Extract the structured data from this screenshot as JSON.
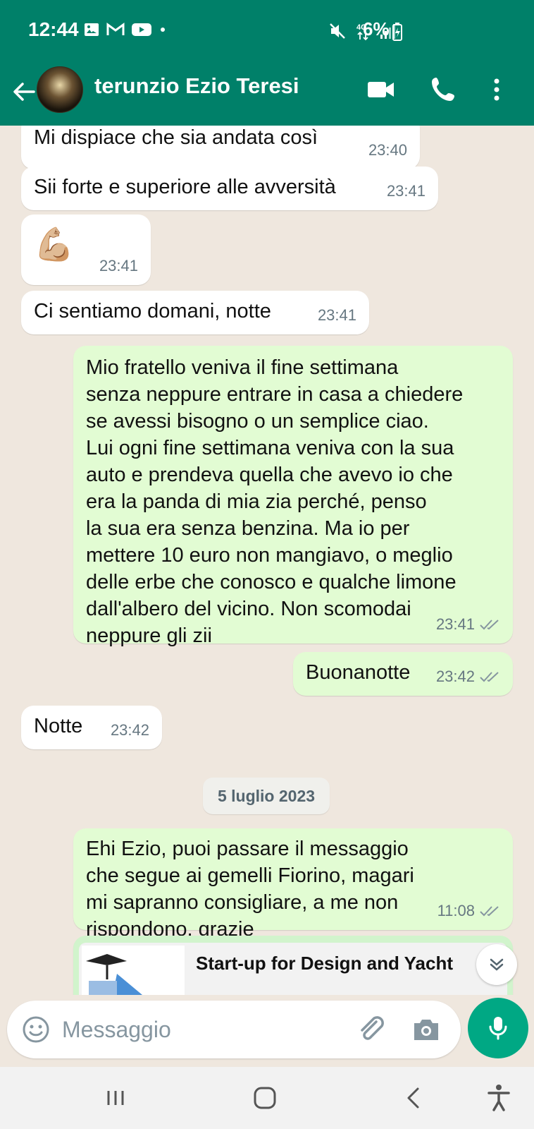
{
  "status_bar": {
    "time": "12:44",
    "battery": "6%",
    "network": "4G",
    "left_icons": [
      "image-icon",
      "gmail-icon",
      "youtube-icon",
      "dot-icon"
    ],
    "right_icons": [
      "mute-icon",
      "network-4g-icon",
      "signal-icon",
      "battery-charging-icon"
    ]
  },
  "header": {
    "contact_name": "terunzio Ezio Teresi",
    "accent_color": "#008069"
  },
  "messages": [
    {
      "dir": "in",
      "text": "Mi dispiace che sia andata così",
      "time": "23:40"
    },
    {
      "dir": "in",
      "text": "Sii forte e superiore alle avversità",
      "time": "23:41"
    },
    {
      "dir": "in",
      "text": "💪🏼",
      "time": "23:41"
    },
    {
      "dir": "in",
      "text": "Ci sentiamo domani, notte",
      "time": "23:41"
    },
    {
      "dir": "out",
      "text": "Mio fratello veniva il fine settimana\nsenza neppure entrare in casa a chiedere\nse avessi bisogno o un semplice ciao.\nLui ogni fine settimana veniva con la sua\nauto e prendeva quella che avevo io che\nera la panda di mia zia perché, penso\nla sua era senza benzina.  Ma io per\nmettere 10 euro non mangiavo, o meglio\ndelle erbe che conosco e qualche limone\ndall'albero del vicino. Non scomodai\nneppure gli zii",
      "time": "23:41"
    },
    {
      "dir": "out",
      "text": "Buonanotte",
      "time": "23:42"
    },
    {
      "dir": "in",
      "text": "Notte",
      "time": "23:42"
    },
    {
      "dir": "out",
      "text": "Ehi Ezio, puoi passare il messaggio\nche segue ai gemelli Fiorino, magari\nmi sapranno consigliare, a me non\nrispondono, grazie",
      "time": "11:08"
    }
  ],
  "date_separator": "5 luglio 2023",
  "link_preview": {
    "title": "Start-up for Design and Yacht"
  },
  "composer": {
    "placeholder": "Messaggio"
  },
  "colors": {
    "outgoing_bubble": "#e2fcd3",
    "incoming_bubble": "#ffffff",
    "mic_button": "#00a884"
  }
}
